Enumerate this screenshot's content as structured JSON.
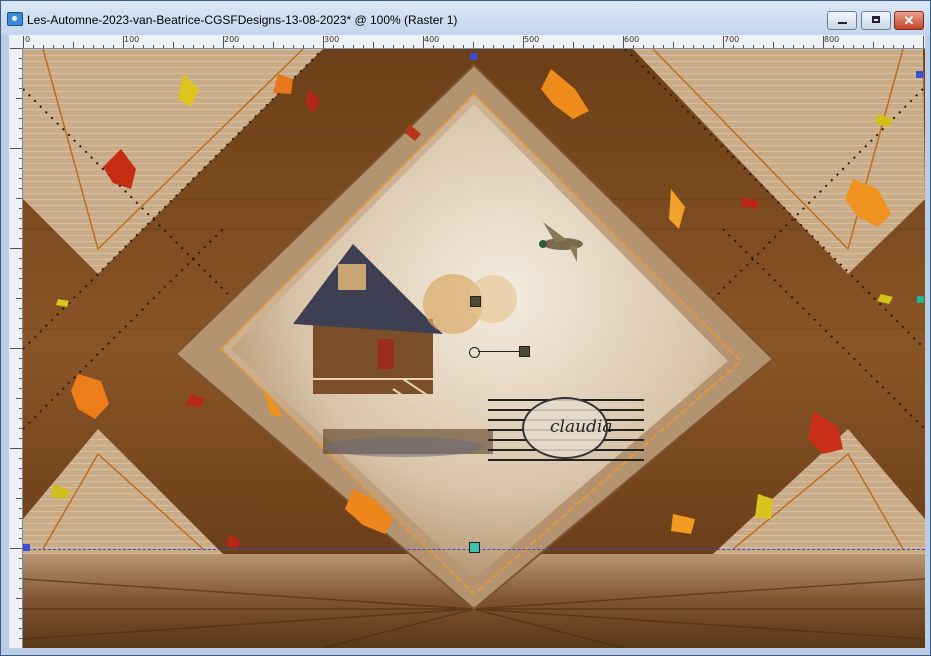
{
  "window": {
    "title": "Les-Automne-2023-van-Beatrice-CGSFDesigns-13-08-2023* @ 100% (Raster 1)",
    "buttons": {
      "minimize": "minimize",
      "maximize": "maximize",
      "close": "✕"
    }
  },
  "ruler": {
    "top_labels": [
      "0",
      "100",
      "200",
      "300",
      "400",
      "500",
      "600",
      "700",
      "800"
    ]
  },
  "watermark": {
    "text": "claudia"
  },
  "colors": {
    "brown_dark": "#5a3414",
    "brown_mid": "#8a5a2e",
    "tan": "#c7a885",
    "cream": "#e9dccb",
    "accent_orange": "#e87a1b",
    "guide_blue": "#3c4bd6",
    "teal_marker": "#1bb89a"
  }
}
